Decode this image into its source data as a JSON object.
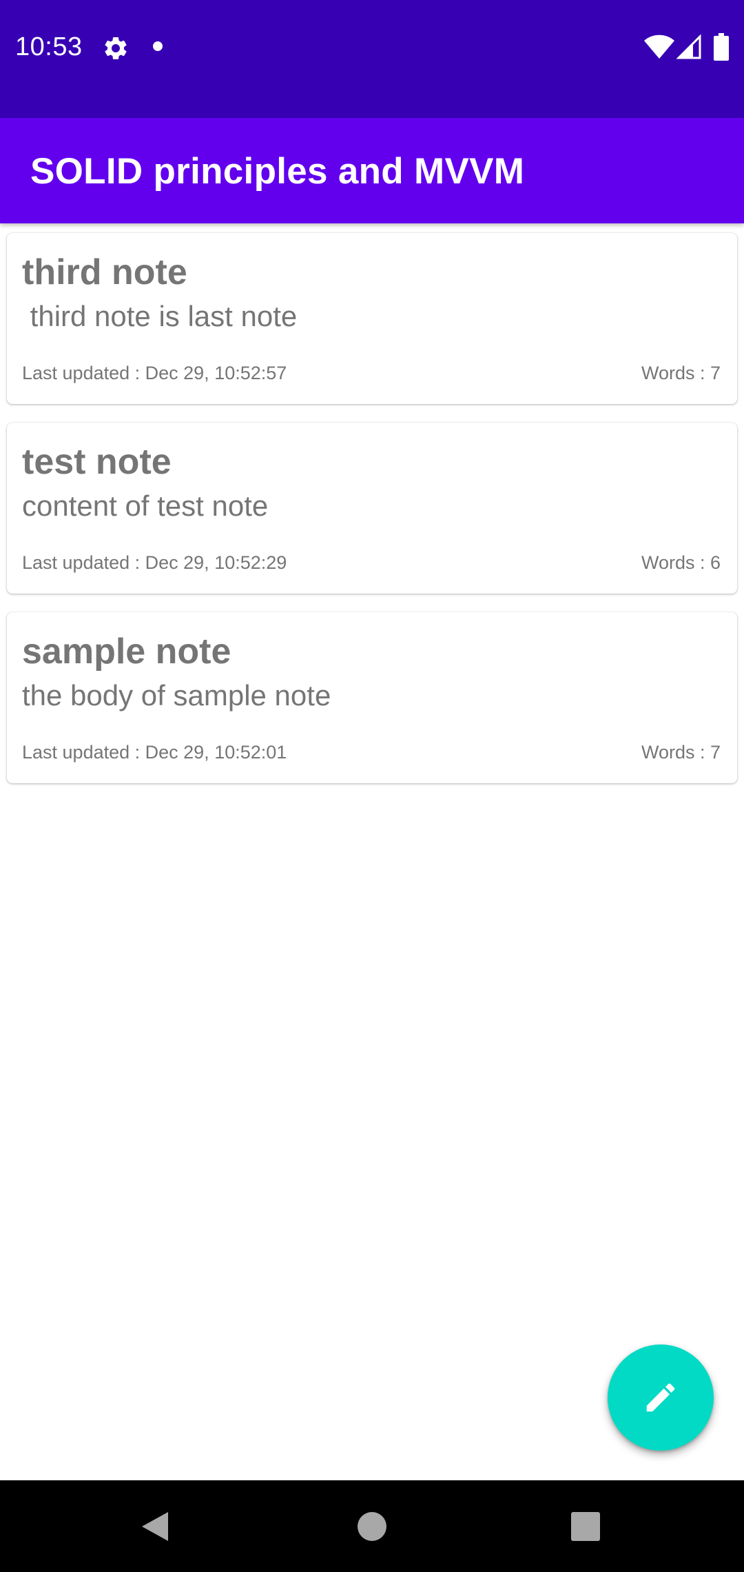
{
  "status_bar": {
    "time": "10:53",
    "icons": [
      "gear-icon",
      "notification-dot-icon",
      "wifi-icon",
      "signal-icon",
      "battery-icon"
    ]
  },
  "app_bar": {
    "title": "SOLID principles and MVVM"
  },
  "notes": [
    {
      "title": "third note",
      "body": " third note is last note",
      "updated": "Last updated : Dec 29, 10:52:57",
      "words": "Words : 7"
    },
    {
      "title": "test note",
      "body": "content of test note",
      "updated": "Last updated : Dec 29, 10:52:29",
      "words": "Words : 6"
    },
    {
      "title": "sample note",
      "body": "the body of sample note",
      "updated": "Last updated : Dec 29, 10:52:01",
      "words": "Words : 7"
    }
  ],
  "fab": {
    "icon": "edit-pencil-icon"
  },
  "nav_bar": {
    "buttons": [
      "back-icon",
      "home-icon",
      "recents-icon"
    ]
  },
  "colors": {
    "status_bar": "#3700b3",
    "app_bar": "#6200ee",
    "fab": "#03dac5",
    "note_text": "#757575"
  }
}
